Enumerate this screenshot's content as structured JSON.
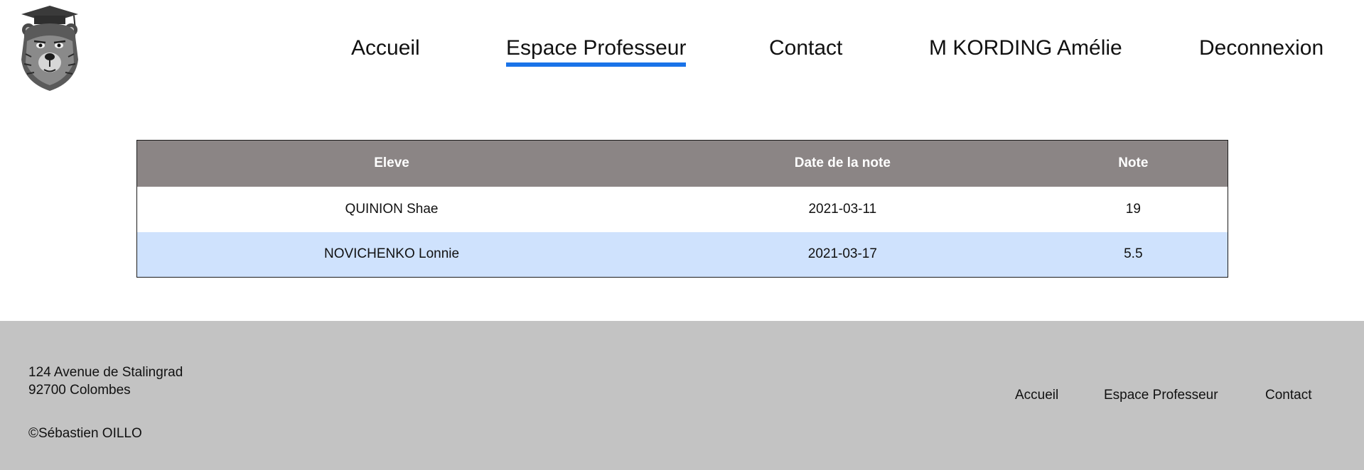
{
  "header": {
    "logo_icon": "bear-with-graduation-cap-logo",
    "nav": {
      "home": "Accueil",
      "teacher_space": "Espace Professeur",
      "contact": "Contact",
      "user": "M KORDING Amélie",
      "logout": "Deconnexion"
    },
    "active_tab": "Espace Professeur",
    "accent_color": "#1a73e8"
  },
  "grades": {
    "columns": {
      "student": "Eleve",
      "date": "Date de la note",
      "grade": "Note"
    },
    "rows": [
      {
        "student": "QUINION Shae",
        "date": "2021-03-11",
        "grade": "19"
      },
      {
        "student": "NOVICHENKO Lonnie",
        "date": "2021-03-17",
        "grade": "5.5"
      }
    ],
    "header_color": "#8b8585",
    "alt_row_color": "#cfe2fd"
  },
  "footer": {
    "address_line1": "124 Avenue de Stalingrad",
    "address_line2": "92700 Colombes",
    "copyright": "©Sébastien OILLO",
    "links": {
      "home": "Accueil",
      "teacher_space": "Espace Professeur",
      "contact": "Contact"
    },
    "background_color": "#c3c3c3"
  }
}
